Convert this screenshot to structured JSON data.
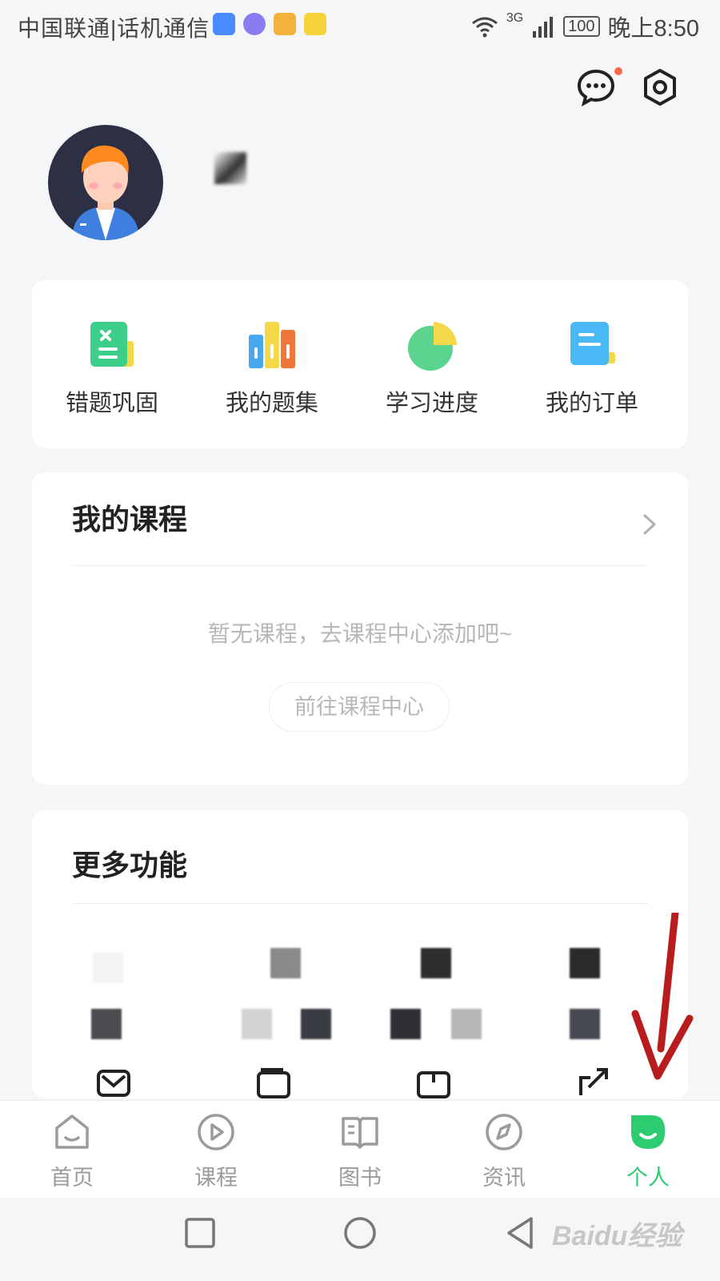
{
  "status_bar": {
    "carrier": "中国联通|话机通信",
    "network": "3G",
    "battery": "100",
    "time": "晚上8:50"
  },
  "quick_actions": [
    {
      "label": "错题巩固",
      "icon": "wrong-questions-icon"
    },
    {
      "label": "我的题集",
      "icon": "question-sets-icon"
    },
    {
      "label": "学习进度",
      "icon": "study-progress-icon"
    },
    {
      "label": "我的订单",
      "icon": "orders-icon"
    }
  ],
  "courses": {
    "title": "我的课程",
    "empty_message": "暂无课程，去课程中心添加吧~",
    "button": "前往课程中心"
  },
  "more": {
    "title": "更多功能"
  },
  "tab_bar": {
    "items": [
      {
        "label": "首页",
        "icon": "home-icon"
      },
      {
        "label": "课程",
        "icon": "play-circle-icon"
      },
      {
        "label": "图书",
        "icon": "book-icon"
      },
      {
        "label": "资讯",
        "icon": "compass-icon"
      },
      {
        "label": "个人",
        "icon": "profile-icon"
      }
    ],
    "active_index": 4,
    "active_color": "#2ecc71",
    "inactive_color": "#9b9b9b"
  },
  "watermark": "Baidu经验"
}
